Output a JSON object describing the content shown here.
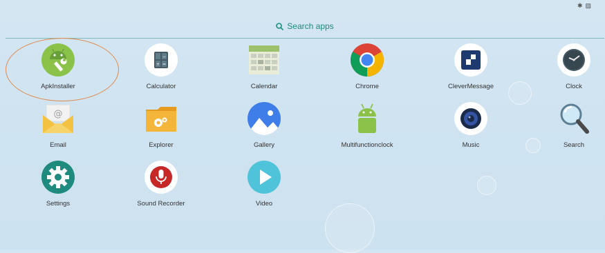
{
  "status": {
    "icons": [
      "bluetooth-icon",
      "no-sim-icon"
    ]
  },
  "search": {
    "label": "Search apps"
  },
  "apps": [
    {
      "label": "ApkInstaller"
    },
    {
      "label": "Calculator"
    },
    {
      "label": "Calendar"
    },
    {
      "label": "Chrome"
    },
    {
      "label": "CleverMessage"
    },
    {
      "label": "Clock"
    },
    {
      "label": "Email"
    },
    {
      "label": "Explorer"
    },
    {
      "label": "Gallery"
    },
    {
      "label": "Multifunctionclock"
    },
    {
      "label": "Music"
    },
    {
      "label": "Search"
    },
    {
      "label": "Settings"
    },
    {
      "label": "Sound Recorder"
    },
    {
      "label": "Video"
    }
  ],
  "colors": {
    "accent": "#1a8c7c",
    "highlight_ring": "#e08a4a",
    "android_green": "#8bc34a"
  }
}
